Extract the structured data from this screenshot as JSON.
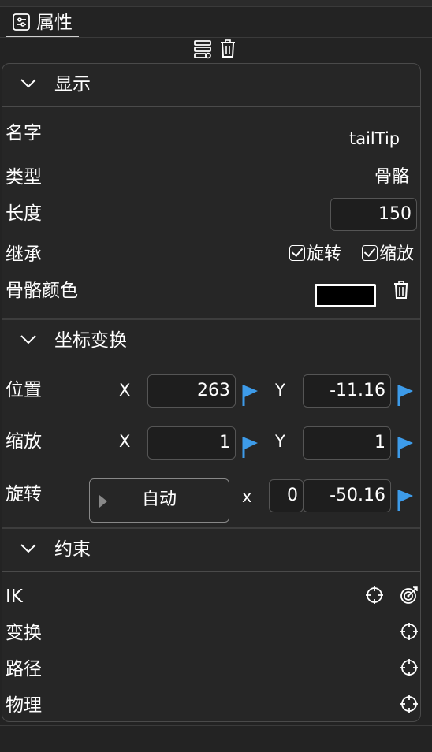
{
  "tab": {
    "label": "属性",
    "icon": "properties-icon"
  },
  "toolbar": {
    "icons": [
      "layers-icon",
      "trash-icon"
    ]
  },
  "display": {
    "title": "显示",
    "name_label": "名字",
    "name_value": "tailTip",
    "type_label": "类型",
    "type_value": "骨骼",
    "length_label": "长度",
    "length_value": "150",
    "inherit_label": "继承",
    "inherit_rotate": "旋转",
    "inherit_scale": "缩放",
    "color_label": "骨骼颜色",
    "color_value": "#000000"
  },
  "transform": {
    "title": "坐标变换",
    "position_label": "位置",
    "position_x": "263",
    "position_y": "-11.16",
    "scale_label": "缩放",
    "scale_x": "1",
    "scale_y": "1",
    "rotate_label": "旋转",
    "rotate_mode": "自动",
    "rotate_axis": "x",
    "rotate_x": "0",
    "rotate_value": "-50.16",
    "x_label": "X",
    "y_label": "Y",
    "flag_color": "#3d9be9"
  },
  "constraints": {
    "title": "约束",
    "items": [
      {
        "label": "IK"
      },
      {
        "label": "变换"
      },
      {
        "label": "路径"
      },
      {
        "label": "物理"
      }
    ]
  }
}
